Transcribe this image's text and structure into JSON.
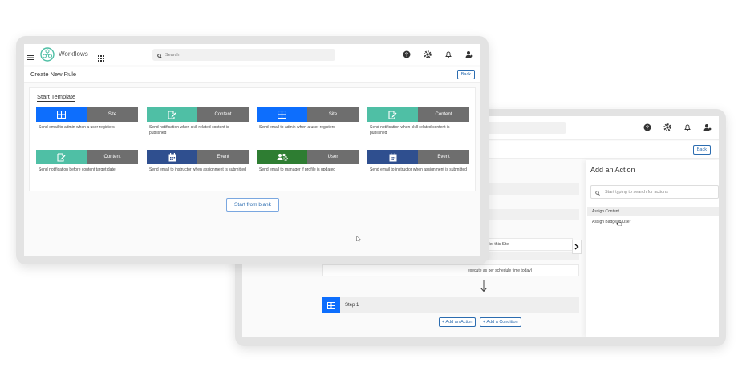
{
  "colors": {
    "blue": "#0d6efd",
    "teal": "#4fbfa5",
    "navy": "#2f4f8f",
    "green": "#2e7d32",
    "gray_tag": "#6e6e6e",
    "link": "#2b6cb0"
  },
  "back_window": {
    "back_label": "Back",
    "row1_text": "nder this Site",
    "row2_text": "execute as per schedule time today)",
    "step_label": "Step 1",
    "add_action_label": "+ Add an Action",
    "add_condition_label": "+ Add a Condition",
    "panel": {
      "title": "Add an Action",
      "search_placeholder": "Start typing to search for actions",
      "items": [
        {
          "label": "Assign Content"
        },
        {
          "label": "Assign Badge to User"
        }
      ]
    }
  },
  "front_window": {
    "app_name": "Workflows",
    "search_placeholder": "Search",
    "page_title": "Create New Rule",
    "back_label": "Back",
    "section_title": "Start Template",
    "templates": [
      {
        "icon": "table-icon",
        "color": "blue",
        "type": "Site",
        "desc": "Send email to admin when a user registers"
      },
      {
        "icon": "edit-doc-icon",
        "color": "teal",
        "type": "Content",
        "desc": "Send notification when skill related content is published"
      },
      {
        "icon": "table-icon",
        "color": "blue",
        "type": "Site",
        "desc": "Send email to admin when a user registers"
      },
      {
        "icon": "edit-doc-icon",
        "color": "teal",
        "type": "Content",
        "desc": "Send notification when skill related content is published"
      },
      {
        "icon": "edit-doc-icon",
        "color": "teal",
        "type": "Content",
        "desc": "Send notification before content target date"
      },
      {
        "icon": "calendar-icon",
        "color": "navy",
        "type": "Event",
        "desc": "Send email to instructor when assignment is submitted"
      },
      {
        "icon": "users-gear-icon",
        "color": "green",
        "type": "User",
        "desc": "Send email to manager if profile is updated"
      },
      {
        "icon": "calendar-icon",
        "color": "navy",
        "type": "Event",
        "desc": "Send email to instructor when assignment is submitted"
      }
    ],
    "start_blank_label": "Start from blank"
  }
}
